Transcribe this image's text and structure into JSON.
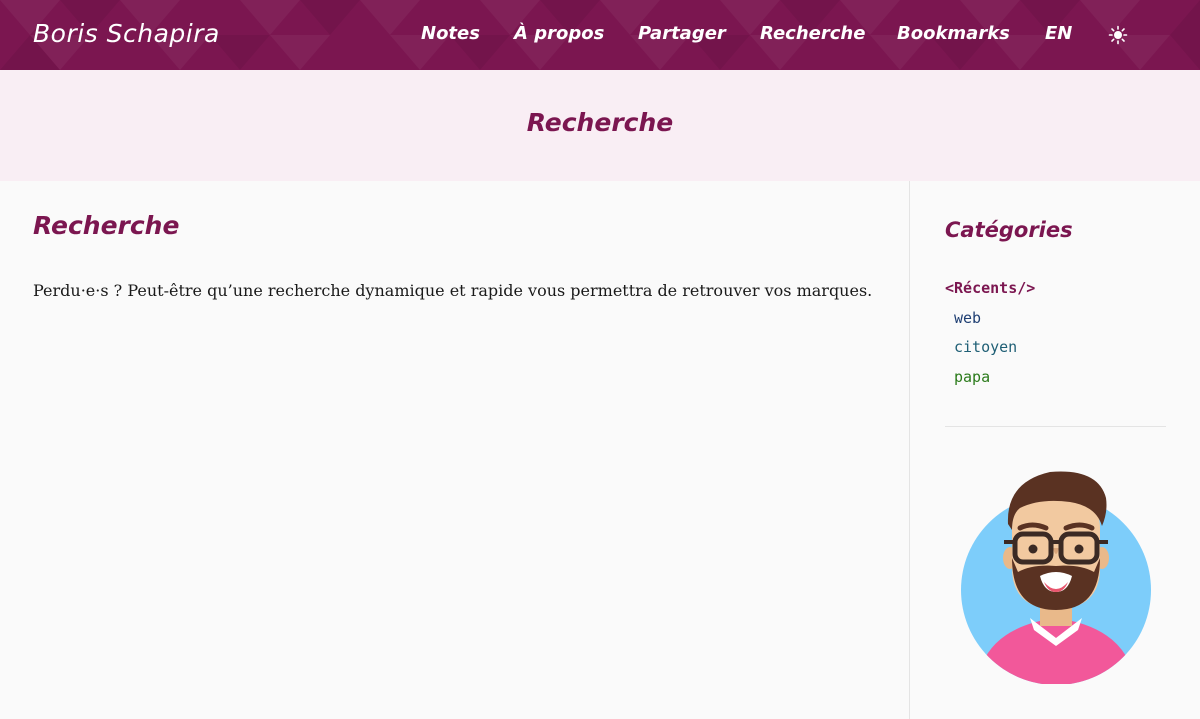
{
  "header": {
    "brand": "Boris Schapira",
    "nav": [
      {
        "label": "Notes"
      },
      {
        "label": "À propos"
      },
      {
        "label": "Partager"
      },
      {
        "label": "Recherche"
      },
      {
        "label": "Bookmarks"
      },
      {
        "label": "EN"
      }
    ],
    "theme_toggle_icon": "sun-icon"
  },
  "hero": {
    "title": "Recherche"
  },
  "main": {
    "heading": "Recherche",
    "intro": "Perdu·e·s ? Peut-être qu’une recherche dynamique et rapide vous permettra de retrouver vos marques."
  },
  "sidebar": {
    "title": "Catégories",
    "categories": [
      {
        "label": "<Récents/>",
        "color": "#7b1650"
      },
      {
        "label": "web",
        "color": "#1f3f73"
      },
      {
        "label": "citoyen",
        "color": "#1f5f75"
      },
      {
        "label": "papa",
        "color": "#2a7a1a"
      }
    ],
    "avatar_icon": "avatar-illustration"
  },
  "colors": {
    "brand": "#7b1650",
    "hero_bg": "#f9eef4",
    "page_bg": "#fafafa"
  }
}
